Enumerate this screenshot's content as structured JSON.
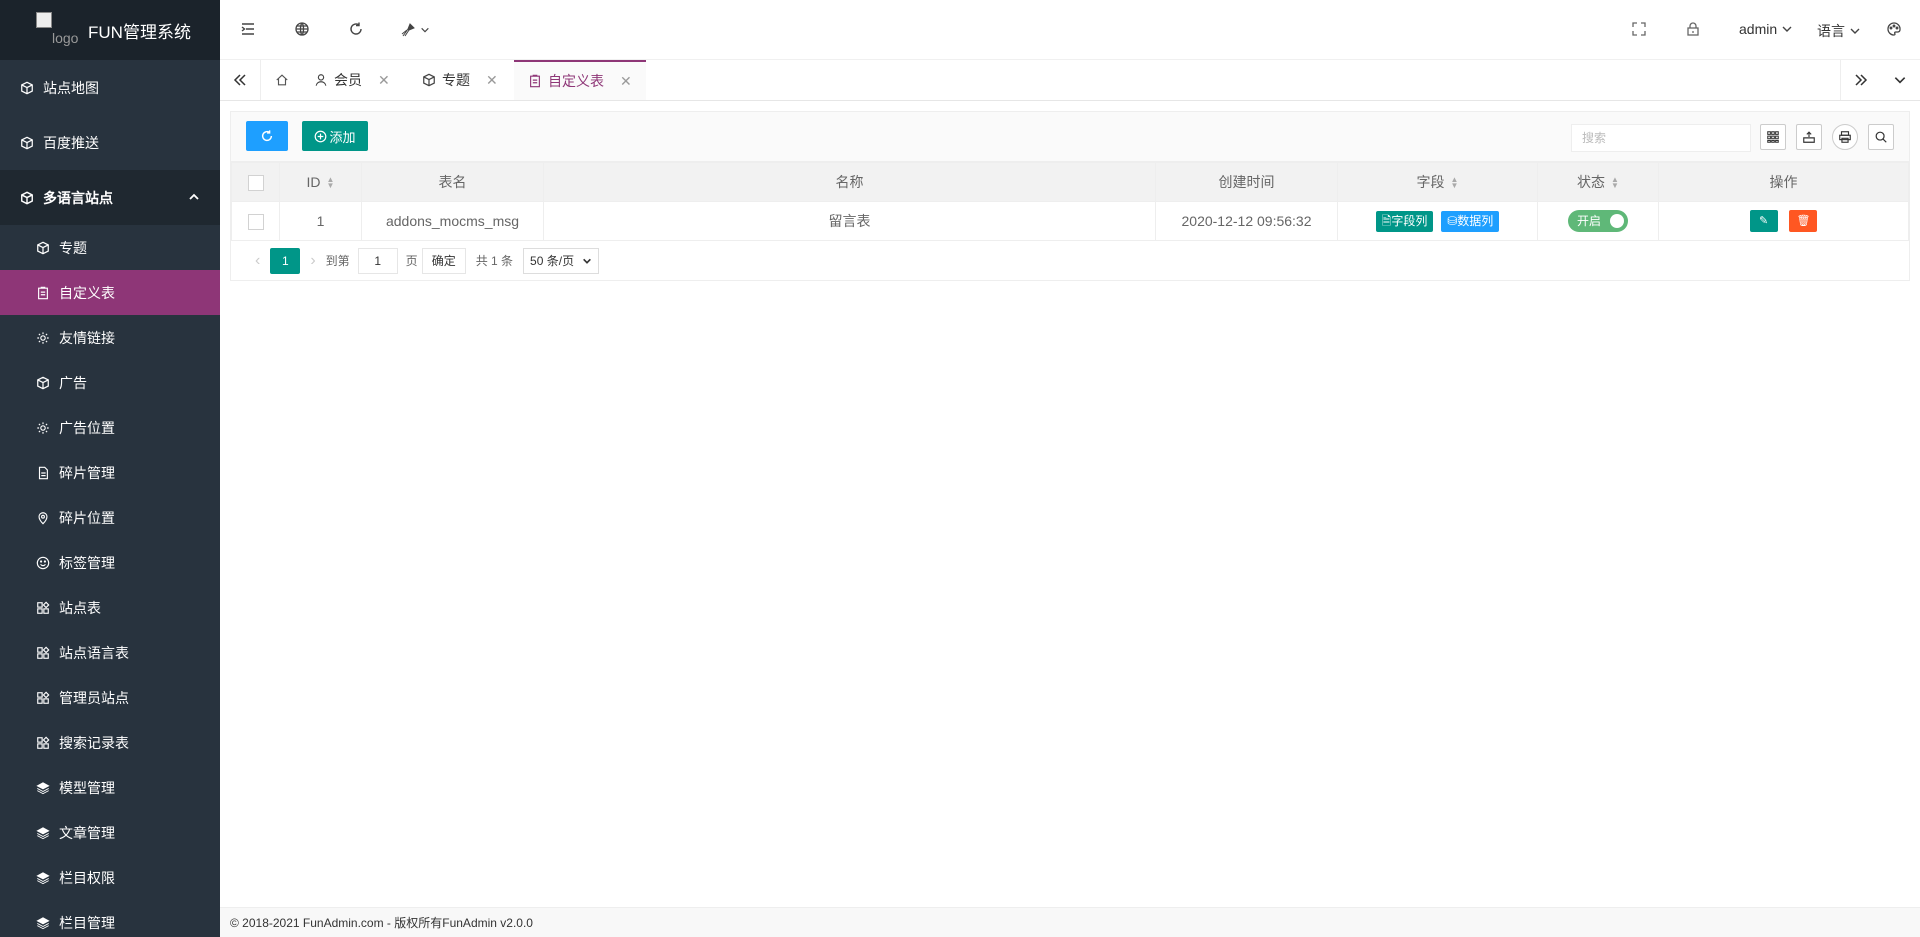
{
  "sidebar": {
    "logo_alt": "logo",
    "title": "FUN管理系统",
    "top_items": [
      {
        "label": "站点地图",
        "icon": "cube-icon"
      },
      {
        "label": "百度推送",
        "icon": "cube-icon"
      }
    ],
    "parent": {
      "label": "多语言站点",
      "icon": "cube-icon"
    },
    "children": [
      {
        "label": "专题",
        "icon": "cube-icon"
      },
      {
        "label": "自定义表",
        "icon": "clipboard-icon",
        "active": true
      },
      {
        "label": "友情链接",
        "icon": "gear-icon"
      },
      {
        "label": "广告",
        "icon": "cube-icon"
      },
      {
        "label": "广告位置",
        "icon": "gear-icon"
      },
      {
        "label": "碎片管理",
        "icon": "file-icon"
      },
      {
        "label": "碎片位置",
        "icon": "location-icon"
      },
      {
        "label": "标签管理",
        "icon": "smile-icon"
      },
      {
        "label": "站点表",
        "icon": "app-icon"
      },
      {
        "label": "站点语言表",
        "icon": "app-icon"
      },
      {
        "label": "管理员站点",
        "icon": "app-icon"
      },
      {
        "label": "搜索记录表",
        "icon": "app-icon"
      },
      {
        "label": "模型管理",
        "icon": "layers-icon"
      },
      {
        "label": "文章管理",
        "icon": "layers-icon"
      },
      {
        "label": "栏目权限",
        "icon": "layers-icon"
      },
      {
        "label": "栏目管理",
        "icon": "layers-icon"
      }
    ]
  },
  "topbar": {
    "user": "admin",
    "language": "语言"
  },
  "tabs": [
    {
      "label": "会员",
      "icon": "user-icon"
    },
    {
      "label": "专题",
      "icon": "cube-icon"
    },
    {
      "label": "自定义表",
      "icon": "clipboard-icon",
      "active": true
    }
  ],
  "toolbar": {
    "add_label": "添加",
    "search_placeholder": "搜索"
  },
  "table": {
    "columns": [
      "ID",
      "表名",
      "名称",
      "创建时间",
      "字段",
      "状态",
      "操作"
    ],
    "rows": [
      {
        "id": "1",
        "table_name": "addons_mocms_msg",
        "name": "留言表",
        "created": "2020-12-12 09:56:32",
        "field_btn": "字段列",
        "data_btn": "数据列",
        "status": "开启"
      }
    ]
  },
  "pager": {
    "current": "1",
    "goto_label": "到第",
    "goto_value": "1",
    "page_label": "页",
    "confirm_label": "确定",
    "total": "共 1 条",
    "per_page": "50 条/页"
  },
  "footer": "© 2018-2021 FunAdmin.com - 版权所有FunAdmin v2.0.0",
  "colors": {
    "sidebar_bg": "#28333e",
    "active_menu": "#8e3677",
    "primary_green": "#009688",
    "primary_blue": "#1e9fff",
    "danger": "#ff5722",
    "switch_on": "#5fb878"
  }
}
